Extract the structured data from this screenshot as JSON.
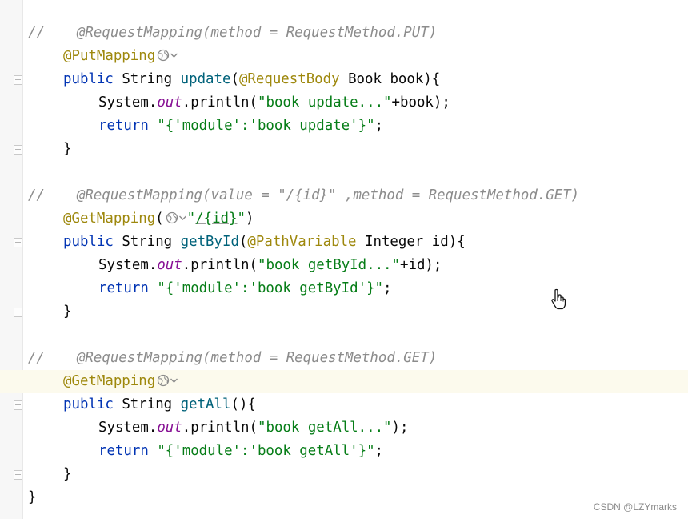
{
  "editor": {
    "blocks": [
      {
        "comment": {
          "slashes": "//",
          "text": "@RequestMapping(method = RequestMethod.PUT)"
        },
        "annotation": "@PutMapping",
        "signature": {
          "modifier": "public",
          "return_type": "String",
          "method": "update",
          "open": "(",
          "param_annotation": "@RequestBody",
          "param_type": "Book",
          "param_name": "book",
          "close": "){"
        },
        "print": {
          "class": "System",
          "dot1": ".",
          "field": "out",
          "dot2": ".",
          "method": "println",
          "open": "(",
          "literal": "\"book update...\"",
          "concat": "+book",
          "close": ");"
        },
        "return": {
          "keyword": "return",
          "literal": "\"{'module':'book update'}\"",
          "end": ";"
        },
        "closing": "}"
      },
      {
        "comment": {
          "slashes": "//",
          "text": "@RequestMapping(value = \"/{id}\" ,method = RequestMethod.GET)"
        },
        "annotation": "@GetMapping",
        "annotation_args": {
          "open": "(",
          "path_open": "\"",
          "path": "/{id}",
          "path_close": "\"",
          "close": ")"
        },
        "signature": {
          "modifier": "public",
          "return_type": "String",
          "method": "getById",
          "open": "(",
          "param_annotation": "@PathVariable",
          "param_type": "Integer",
          "param_name": "id",
          "close": "){"
        },
        "print": {
          "class": "System",
          "dot1": ".",
          "field": "out",
          "dot2": ".",
          "method": "println",
          "open": "(",
          "literal": "\"book getById...\"",
          "concat": "+id",
          "close": ");"
        },
        "return": {
          "keyword": "return",
          "literal": "\"{'module':'book getById'}\"",
          "end": ";"
        },
        "closing": "}"
      },
      {
        "comment": {
          "slashes": "//",
          "text": "@RequestMapping(method = RequestMethod.GET)"
        },
        "annotation": "@GetMapping",
        "signature": {
          "modifier": "public",
          "return_type": "String",
          "method": "getAll",
          "open": "(",
          "close": "){"
        },
        "print": {
          "class": "System",
          "dot1": ".",
          "field": "out",
          "dot2": ".",
          "method": "println",
          "open": "(",
          "literal": "\"book getAll...\"",
          "close": ");"
        },
        "return": {
          "keyword": "return",
          "literal": "\"{'module':'book getAll'}\"",
          "end": ";"
        },
        "closing": "}"
      }
    ],
    "class_closing": "}"
  },
  "icons": {
    "gutter_web": "web-endpoint-icon",
    "dropdown": "chevron-down-icon",
    "cursor": "hand-pointer-icon"
  },
  "colors": {
    "keyword": "#0033b3",
    "method": "#00627a",
    "string": "#067d17",
    "annotation": "#9e880d",
    "comment": "#8c8c8c",
    "field": "#871094",
    "current_line": "#fcfaed"
  },
  "watermark": "CSDN @LZYmarks"
}
